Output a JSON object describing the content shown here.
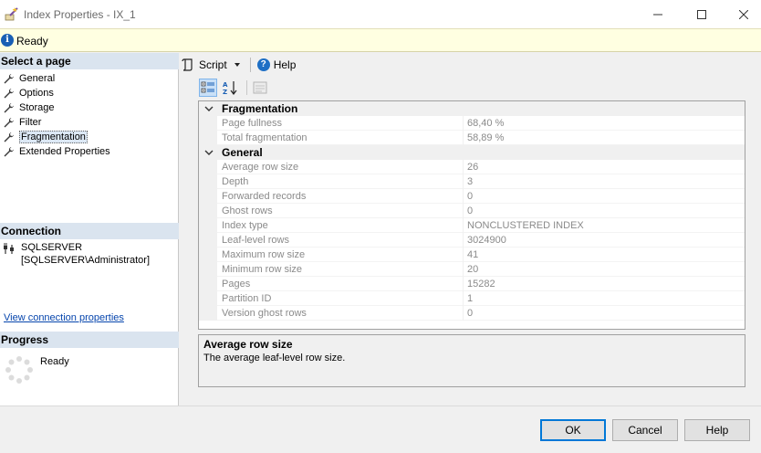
{
  "window": {
    "title": "Index Properties - IX_1",
    "app_icon": "ssms-wand-icon",
    "controls": [
      "minimize-icon",
      "maximize-icon",
      "close-icon"
    ]
  },
  "status": {
    "text": "Ready",
    "icon": "info-icon"
  },
  "left": {
    "select_page_header": "Select a page",
    "pages": [
      {
        "label": "General"
      },
      {
        "label": "Options"
      },
      {
        "label": "Storage"
      },
      {
        "label": "Filter"
      },
      {
        "label": "Fragmentation"
      },
      {
        "label": "Extended Properties"
      }
    ],
    "selected_page": "Fragmentation",
    "connection_header": "Connection",
    "server": "SQLSERVER",
    "user": "[SQLSERVER\\Administrator]",
    "connection_link": "View connection properties",
    "progress_header": "Progress",
    "progress_status": "Ready"
  },
  "toolbar": {
    "script_label": "Script",
    "help_label": "Help"
  },
  "grid": {
    "categories": [
      {
        "label": "Fragmentation",
        "rows": [
          {
            "name": "Page fullness",
            "value": "68,40 %"
          },
          {
            "name": "Total fragmentation",
            "value": "58,89 %"
          }
        ]
      },
      {
        "label": "General",
        "rows": [
          {
            "name": "Average row size",
            "value": "26"
          },
          {
            "name": "Depth",
            "value": "3"
          },
          {
            "name": "Forwarded records",
            "value": "0"
          },
          {
            "name": "Ghost rows",
            "value": "0"
          },
          {
            "name": "Index type",
            "value": "NONCLUSTERED INDEX"
          },
          {
            "name": "Leaf-level rows",
            "value": "3024900"
          },
          {
            "name": "Maximum row size",
            "value": "41"
          },
          {
            "name": "Minimum row size",
            "value": "20"
          },
          {
            "name": "Pages",
            "value": "15282"
          },
          {
            "name": "Partition ID",
            "value": "1"
          },
          {
            "name": "Version ghost rows",
            "value": "0"
          }
        ]
      }
    ]
  },
  "description": {
    "title": "Average row size",
    "text": "The average leaf-level row size."
  },
  "buttons": {
    "ok": "OK",
    "cancel": "Cancel",
    "help": "Help"
  },
  "colors": {
    "section_header_bg": "#dae4ef",
    "status_bg": "#ffffe1",
    "default_button_border": "#0078d7"
  }
}
